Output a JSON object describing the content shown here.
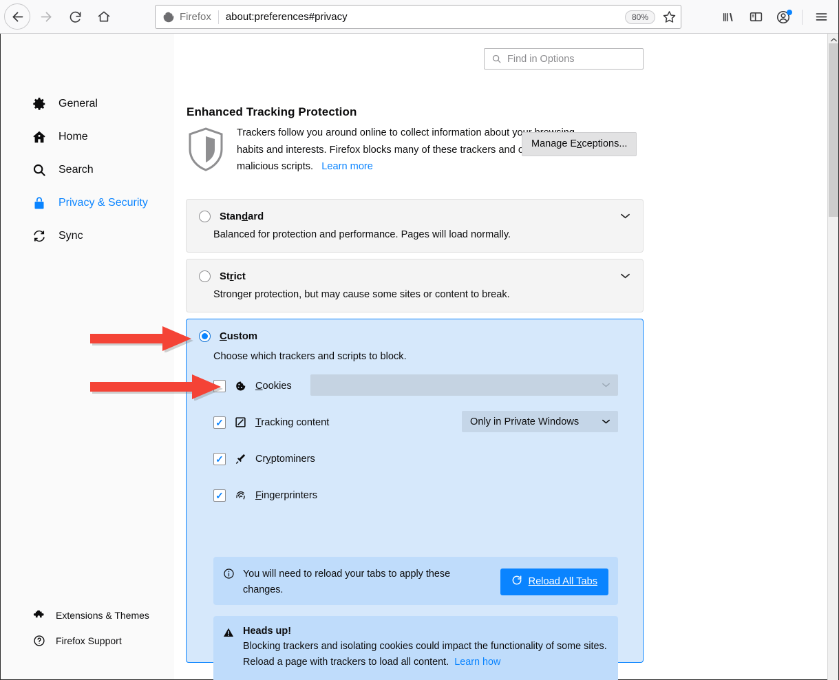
{
  "browser": {
    "back_icon": "back-arrow",
    "forward_icon": "forward-arrow",
    "reload_icon": "reload",
    "home_icon": "home",
    "brand_label": "Firefox",
    "url": "about:preferences#privacy",
    "zoom_level": "80%",
    "bookmark_icon": "star",
    "library_icon": "library",
    "sidebar_icon": "sidebar",
    "account_icon": "account",
    "menu_icon": "hamburger-menu"
  },
  "search": {
    "placeholder": "Find in Options",
    "value": ""
  },
  "sidebar": {
    "items": [
      {
        "label": "General",
        "icon": "gear-icon",
        "active": false
      },
      {
        "label": "Home",
        "icon": "home-icon",
        "active": false
      },
      {
        "label": "Search",
        "icon": "search-icon",
        "active": false
      },
      {
        "label": "Privacy & Security",
        "icon": "lock-icon",
        "active": true
      },
      {
        "label": "Sync",
        "icon": "sync-icon",
        "active": false
      }
    ],
    "bottom_items": [
      {
        "label": "Extensions & Themes",
        "icon": "puzzle-icon"
      },
      {
        "label": "Firefox Support",
        "icon": "question-icon"
      }
    ]
  },
  "main": {
    "heading": "Enhanced Tracking Protection",
    "intro_text_1": "Trackers follow you around online to collect information about your browsing habits and interests. Firefox blocks many of these trackers and other malicious scripts.",
    "learn_more": "Learn more",
    "manage_exceptions": "Manage Exceptions...",
    "manage_exceptions_pre": "Manage E",
    "manage_exceptions_key": "x",
    "manage_exceptions_post": "ceptions...",
    "options": [
      {
        "title": "Standard",
        "title_pre": "Stan",
        "title_key": "d",
        "title_post": "ard",
        "description": "Balanced for protection and performance. Pages will load normally.",
        "selected": false
      },
      {
        "title": "Strict",
        "title_pre": "St",
        "title_key": "r",
        "title_post": "ict",
        "description": "Stronger protection, but may cause some sites or content to break.",
        "selected": false
      },
      {
        "title": "Custom",
        "title_pre": "",
        "title_key": "C",
        "title_post": "ustom",
        "description": "Choose which trackers and scripts to block.",
        "selected": true
      }
    ],
    "custom": {
      "checkboxes": [
        {
          "label": "Cookies",
          "label_pre": "",
          "label_key": "C",
          "label_post": "ookies",
          "icon": "cookie-icon",
          "checked": false,
          "dropdown_value": "",
          "dropdown_disabled": true
        },
        {
          "label": "Tracking content",
          "label_pre": "",
          "label_key": "T",
          "label_post": "racking content",
          "icon": "tracking-content-icon",
          "checked": true,
          "dropdown_value": "Only in Private Windows",
          "dropdown_disabled": false
        },
        {
          "label": "Cryptominers",
          "label_pre": "Cr",
          "label_key": "y",
          "label_post": "ptominers",
          "icon": "cryptominer-icon",
          "checked": true,
          "dropdown_value": null,
          "dropdown_disabled": false
        },
        {
          "label": "Fingerprinters",
          "label_pre": "",
          "label_key": "F",
          "label_post": "ingerprinters",
          "icon": "fingerprint-icon",
          "checked": true,
          "dropdown_value": null,
          "dropdown_disabled": false
        }
      ],
      "reload_notice": {
        "icon": "info-icon",
        "text": "You will need to reload your tabs to apply these changes.",
        "button_label": "Reload All Tabs",
        "button_icon": "reload-icon"
      },
      "heads_up": {
        "icon": "warning-icon",
        "title": "Heads up!",
        "text": "Blocking trackers and isolating cookies could impact the functionality of some sites. Reload a page with trackers to load all content.",
        "link": "Learn how"
      }
    }
  },
  "annotations": {
    "arrow_color": "#f44336",
    "arrows": [
      {
        "name": "arrow-pointing-custom-radio"
      },
      {
        "name": "arrow-pointing-cookies-checkbox"
      }
    ]
  }
}
